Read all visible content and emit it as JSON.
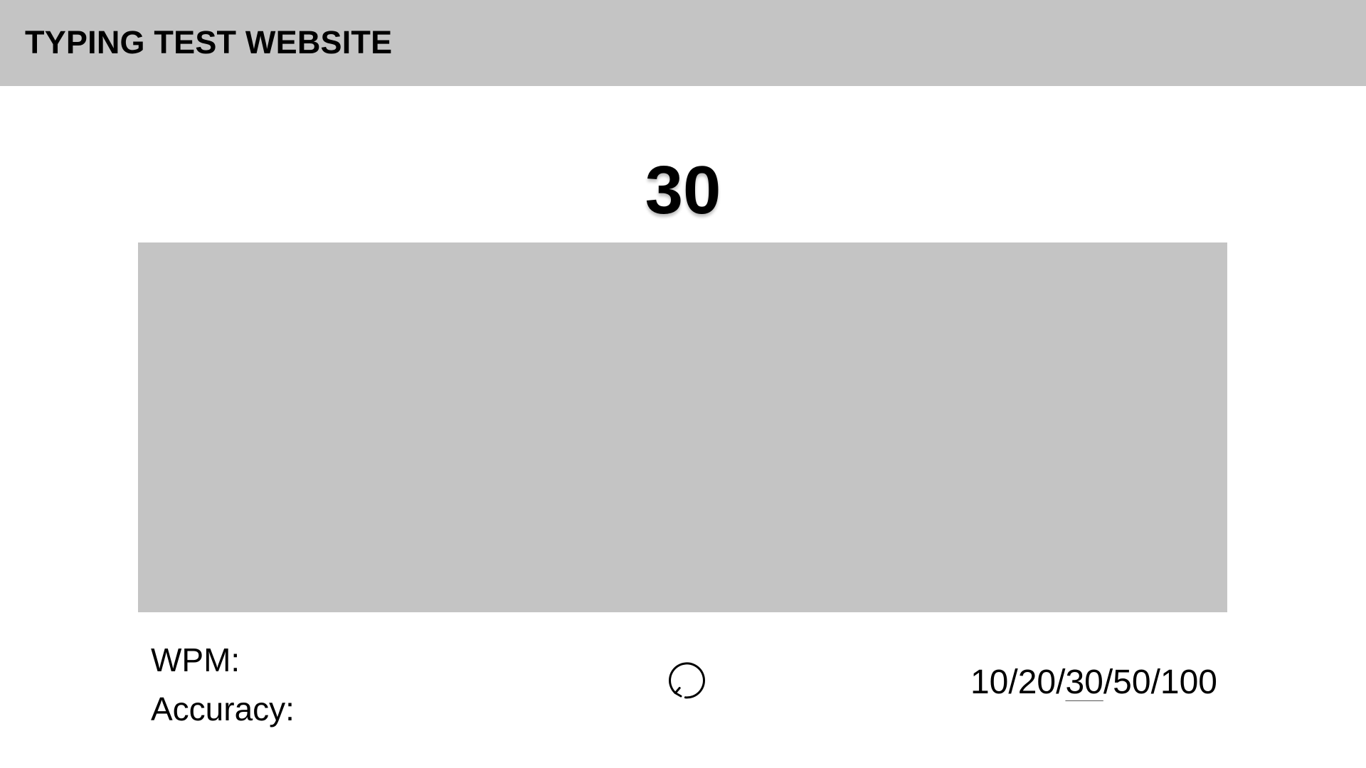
{
  "header": {
    "title": "TYPING TEST WEBSITE",
    "background": "#c4c4c4"
  },
  "test": {
    "current_count": "30",
    "text_area_background": "#c4c4c4"
  },
  "stats": {
    "wpm_label": "WPM:",
    "accuracy_label": "Accuracy:"
  },
  "controls": {
    "restart_icon": "restart-icon"
  },
  "word_count_options": {
    "options": [
      "10",
      "20",
      "30",
      "50",
      "100"
    ],
    "separator": "/",
    "selected": "30"
  }
}
